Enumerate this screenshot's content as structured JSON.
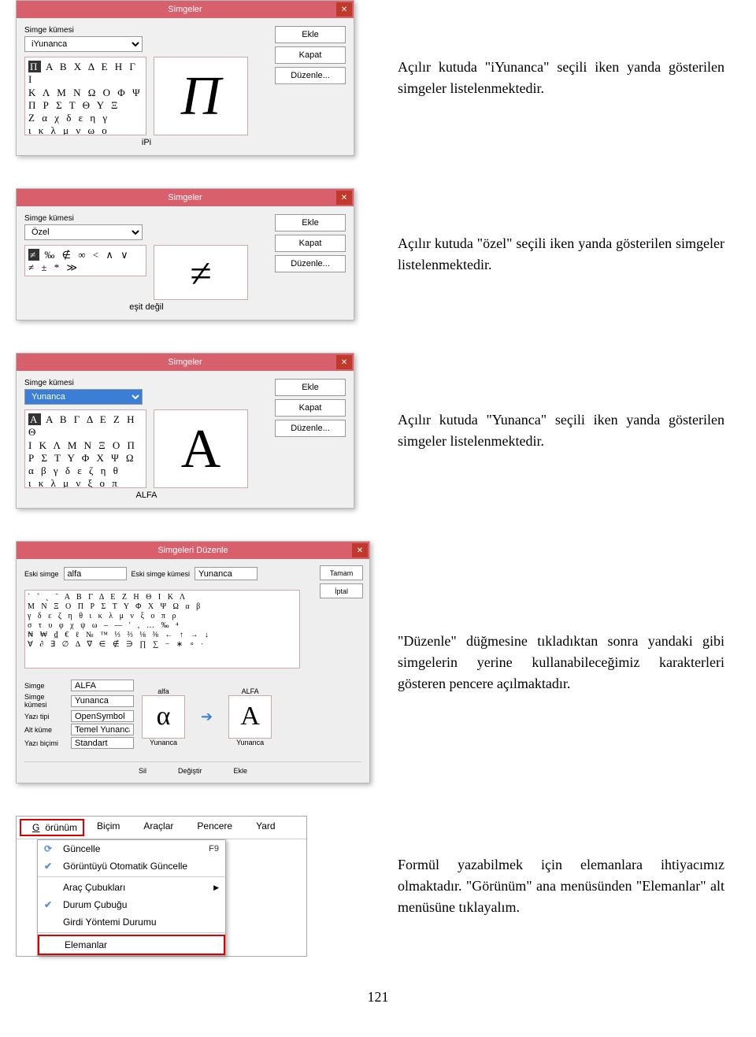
{
  "descriptions": {
    "d1": "Açılır kutuda \"iYunanca\" seçili iken yanda gösterilen simgeler listelenmektedir.",
    "d2": "Açılır kutuda \"özel\" seçili iken yanda gösterilen simgeler listelenmektedir.",
    "d3": "Açılır kutuda \"Yunanca\" seçili iken yanda gösterilen simgeler listelenmektedir.",
    "d4": "\"Düzenle\" düğmesine tıkladıktan sonra yandaki gibi simgelerin yerine kullanabileceğimiz karakterleri gösteren pencere açılmaktadır.",
    "d5": "Formül yazabilmek için elemanlara ihtiyacımız olmaktadır. \"Görünüm\" ana menüsünden \"Elemanlar\" alt menüsüne tıklayalım."
  },
  "dlg": {
    "title": "Simgeler",
    "set_label": "Simge kümesi",
    "btn_ekle": "Ekle",
    "btn_kapat": "Kapat",
    "btn_duzenle": "Düzenle...",
    "set1": "iYunanca",
    "set2": "Özel",
    "set3": "Yunanca",
    "prev1": "Π",
    "cap1": "iPi",
    "prev2": "≠",
    "cap2": "eşit değil",
    "prev3": "A",
    "cap3": "ALFA",
    "grid_greek": "Α Β Χ Δ Ε Η Γ Ι\nΚ Λ Μ Ν Ω Ο Φ Ψ\nΠ Ρ Σ Τ Θ Υ Ξ\nΖ α χ δ ε η γ\nι κ λ μ ν ω ο\nπ ψ ρ σ θ υ ε φ",
    "grid_ozel": "‰ ∉ ∞ < ∧ ∨\n≠ ± * ≫",
    "grid_yun": "Α Β Γ Δ Ε Ζ Η Θ\nΙ Κ Λ Μ Ν Ξ Ο Π\nΡ Σ Τ Υ Φ Χ Ψ Ω\nα β γ δ ε ζ η θ\nι κ λ μ ν ξ ο π\nρ ς σ τ υ φ χ ψ"
  },
  "edit": {
    "title": "Simgeleri Düzenle",
    "old_sym": "Eski simge",
    "old_set": "Eski simge kümesi",
    "alfa": "alfa",
    "yun": "Yunanca",
    "btn_tamam": "Tamam",
    "btn_iptal": "İptal",
    "p_simge": "Simge",
    "p_set": "Simge kümesi",
    "p_font": "Yazı tipi",
    "p_alt": "Alt küme",
    "p_style": "Yazı biçimi",
    "v_alfa": "ALFA",
    "v_yun": "Yunanca",
    "v_open": "OpenSymbol",
    "v_temel": "Temel Yunanca",
    "v_std": "Standart",
    "alpha_lc": "α",
    "alpha_uc": "A",
    "cap_a": "alfa",
    "cap_b": "ALFA",
    "cap_y": "Yunanca",
    "foot_sil": "Sil",
    "foot_deg": "Değiştir",
    "foot_ekle": "Ekle"
  },
  "menu": {
    "m_gorunum": "Görünüm",
    "m_bicim": "Biçim",
    "m_araclar": "Araçlar",
    "m_pencere": "Pencere",
    "m_yard": "Yard",
    "i_guncelle": "Güncelle",
    "sc_f9": "F9",
    "i_otomatik": "Görüntüyü Otomatik Güncelle",
    "i_arac": "Araç Çubukları",
    "i_durum": "Durum Çubuğu",
    "i_girdi": "Girdi Yöntemi Durumu",
    "i_elemanlar": "Elemanlar"
  },
  "pagenum": "121"
}
